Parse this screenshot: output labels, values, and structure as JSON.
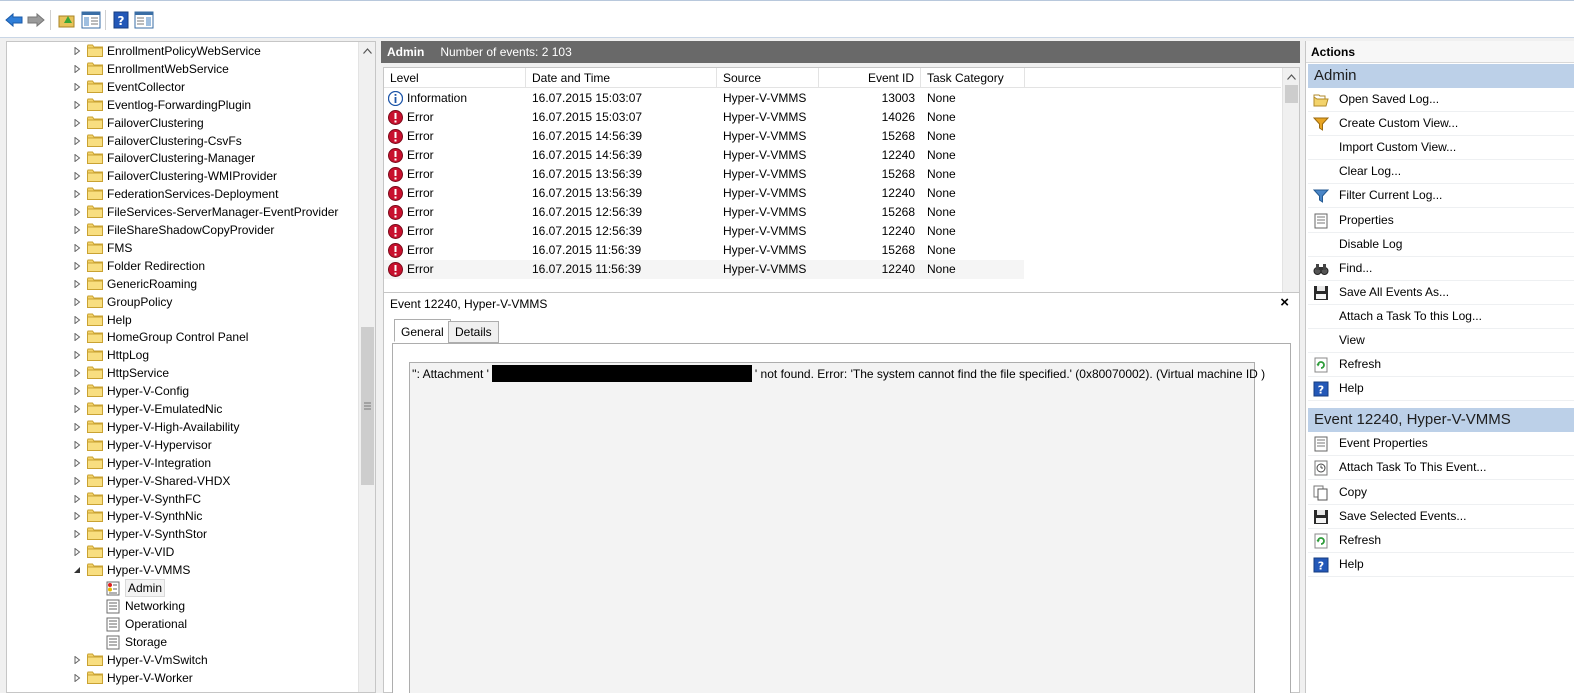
{
  "toolbar": {
    "buttons": [
      "back-icon",
      "forward-icon",
      "up-folder-icon",
      "show-hide-console-tree-icon",
      "help-icon",
      "show-hide-action-pane-icon"
    ]
  },
  "tree": {
    "items": [
      {
        "label": "EnrollmentPolicyWebService",
        "expanded": false
      },
      {
        "label": "EnrollmentWebService",
        "expanded": false
      },
      {
        "label": "EventCollector",
        "expanded": false
      },
      {
        "label": "Eventlog-ForwardingPlugin",
        "expanded": false
      },
      {
        "label": "FailoverClustering",
        "expanded": false
      },
      {
        "label": "FailoverClustering-CsvFs",
        "expanded": false
      },
      {
        "label": "FailoverClustering-Manager",
        "expanded": false
      },
      {
        "label": "FailoverClustering-WMIProvider",
        "expanded": false
      },
      {
        "label": "FederationServices-Deployment",
        "expanded": false
      },
      {
        "label": "FileServices-ServerManager-EventProvider",
        "expanded": false
      },
      {
        "label": "FileShareShadowCopyProvider",
        "expanded": false
      },
      {
        "label": "FMS",
        "expanded": false
      },
      {
        "label": "Folder Redirection",
        "expanded": false
      },
      {
        "label": "GenericRoaming",
        "expanded": false
      },
      {
        "label": "GroupPolicy",
        "expanded": false
      },
      {
        "label": "Help",
        "expanded": false
      },
      {
        "label": "HomeGroup Control Panel",
        "expanded": false
      },
      {
        "label": "HttpLog",
        "expanded": false
      },
      {
        "label": "HttpService",
        "expanded": false
      },
      {
        "label": "Hyper-V-Config",
        "expanded": false
      },
      {
        "label": "Hyper-V-EmulatedNic",
        "expanded": false
      },
      {
        "label": "Hyper-V-High-Availability",
        "expanded": false
      },
      {
        "label": "Hyper-V-Hypervisor",
        "expanded": false
      },
      {
        "label": "Hyper-V-Integration",
        "expanded": false
      },
      {
        "label": "Hyper-V-Shared-VHDX",
        "expanded": false
      },
      {
        "label": "Hyper-V-SynthFC",
        "expanded": false
      },
      {
        "label": "Hyper-V-SynthNic",
        "expanded": false
      },
      {
        "label": "Hyper-V-SynthStor",
        "expanded": false
      },
      {
        "label": "Hyper-V-VID",
        "expanded": false
      },
      {
        "label": "Hyper-V-VMMS",
        "expanded": true
      }
    ],
    "vmms_children": [
      {
        "label": "Admin",
        "selected": true
      },
      {
        "label": "Networking",
        "selected": false
      },
      {
        "label": "Operational",
        "selected": false
      },
      {
        "label": "Storage",
        "selected": false
      }
    ],
    "trailing_items": [
      {
        "label": "Hyper-V-VmSwitch",
        "expanded": false
      },
      {
        "label": "Hyper-V-Worker",
        "expanded": false
      }
    ],
    "scroll_thumb_fraction": 0.25
  },
  "center": {
    "title": "Admin",
    "count": "Number of events: 2 103",
    "columns": [
      "Level",
      "Date and Time",
      "Source",
      "Event ID",
      "Task Category"
    ],
    "rows": [
      {
        "level": "Information",
        "icon": "info-icon",
        "date": "16.07.2015 15:03:07",
        "source": "Hyper-V-VMMS",
        "id": "13003",
        "category": "None"
      },
      {
        "level": "Error",
        "icon": "error-icon",
        "date": "16.07.2015 15:03:07",
        "source": "Hyper-V-VMMS",
        "id": "14026",
        "category": "None"
      },
      {
        "level": "Error",
        "icon": "error-icon",
        "date": "16.07.2015 14:56:39",
        "source": "Hyper-V-VMMS",
        "id": "15268",
        "category": "None"
      },
      {
        "level": "Error",
        "icon": "error-icon",
        "date": "16.07.2015 14:56:39",
        "source": "Hyper-V-VMMS",
        "id": "12240",
        "category": "None"
      },
      {
        "level": "Error",
        "icon": "error-icon",
        "date": "16.07.2015 13:56:39",
        "source": "Hyper-V-VMMS",
        "id": "15268",
        "category": "None"
      },
      {
        "level": "Error",
        "icon": "error-icon",
        "date": "16.07.2015 13:56:39",
        "source": "Hyper-V-VMMS",
        "id": "12240",
        "category": "None"
      },
      {
        "level": "Error",
        "icon": "error-icon",
        "date": "16.07.2015 12:56:39",
        "source": "Hyper-V-VMMS",
        "id": "15268",
        "category": "None"
      },
      {
        "level": "Error",
        "icon": "error-icon",
        "date": "16.07.2015 12:56:39",
        "source": "Hyper-V-VMMS",
        "id": "12240",
        "category": "None"
      },
      {
        "level": "Error",
        "icon": "error-icon",
        "date": "16.07.2015 11:56:39",
        "source": "Hyper-V-VMMS",
        "id": "15268",
        "category": "None"
      },
      {
        "level": "Error",
        "icon": "error-icon",
        "date": "16.07.2015 11:56:39",
        "source": "Hyper-V-VMMS",
        "id": "12240",
        "category": "None"
      }
    ],
    "detail": {
      "title": "Event 12240, Hyper-V-VMMS",
      "close": "×",
      "tabs": [
        "General",
        "Details"
      ],
      "message_pre": "'': Attachment '",
      "message_post": "' not found. Error: 'The system cannot find the file specified.' (0x80070002). (Virtual machine ID )"
    }
  },
  "actions": {
    "header": "Actions",
    "sections": [
      {
        "title": "Admin",
        "items": [
          {
            "label": "Open Saved Log...",
            "icon": "open-saved-log-icon"
          },
          {
            "label": "Create Custom View...",
            "icon": "create-custom-view-icon"
          },
          {
            "label": "Import Custom View...",
            "icon": ""
          },
          {
            "label": "Clear Log...",
            "icon": ""
          },
          {
            "label": "Filter Current Log...",
            "icon": "filter-icon"
          },
          {
            "label": "Properties",
            "icon": "properties-icon"
          },
          {
            "label": "Disable Log",
            "icon": ""
          },
          {
            "label": "Find...",
            "icon": "binoculars-icon"
          },
          {
            "label": "Save All Events As...",
            "icon": "save-icon"
          },
          {
            "label": "Attach a Task To this Log...",
            "icon": ""
          },
          {
            "label": "View",
            "icon": ""
          },
          {
            "label": "Refresh",
            "icon": "refresh-icon"
          },
          {
            "label": "Help",
            "icon": "help-icon"
          }
        ]
      },
      {
        "title": "Event 12240, Hyper-V-VMMS",
        "items": [
          {
            "label": "Event Properties",
            "icon": "properties-icon"
          },
          {
            "label": "Attach Task To This Event...",
            "icon": "attach-task-icon"
          },
          {
            "label": "Copy",
            "icon": "copy-icon"
          },
          {
            "label": "Save Selected Events...",
            "icon": "save-icon"
          },
          {
            "label": "Refresh",
            "icon": "refresh-icon"
          },
          {
            "label": "Help",
            "icon": "help-icon"
          }
        ]
      }
    ]
  },
  "colors": {
    "header_bg": "#696969",
    "section_bg": "#bcd0e8",
    "error_red": "#c8102e",
    "info_blue": "#1d55a8",
    "folder_yellow": "#f3d36b"
  }
}
